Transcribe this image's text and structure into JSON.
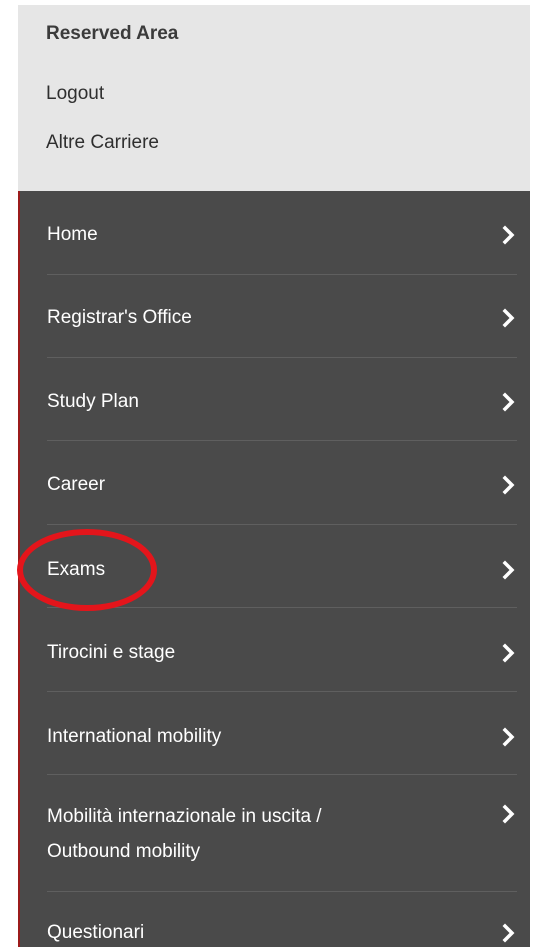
{
  "reserved": {
    "title": "Reserved Area",
    "links": [
      "Logout",
      "Altre Carriere"
    ]
  },
  "menu": {
    "items": [
      {
        "label": "Home"
      },
      {
        "label": "Registrar's Office"
      },
      {
        "label": "Study Plan"
      },
      {
        "label": "Career"
      },
      {
        "label": "Exams"
      },
      {
        "label": "Tirocini e stage"
      },
      {
        "label": "International mobility"
      },
      {
        "label": "Mobilità internazionale in uscita /",
        "label2": "Outbound mobility"
      },
      {
        "label": "Questionari"
      }
    ]
  },
  "colors": {
    "panel_gray": "#e6e6e6",
    "menu_dark": "#4a4a4a",
    "highlight_red": "#e4151b"
  }
}
